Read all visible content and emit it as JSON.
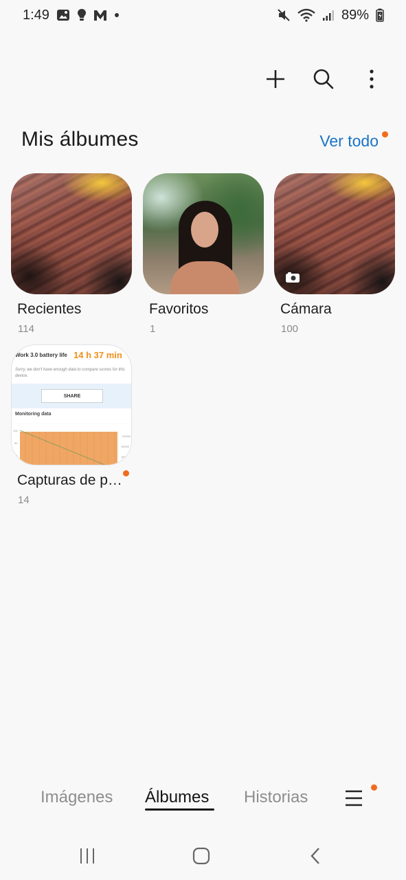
{
  "status_bar": {
    "time": "1:49",
    "battery": "89%",
    "icons": [
      "gallery-icon",
      "bulb-icon",
      "m-app-icon",
      "dot-icon",
      "mute-icon",
      "wifi-icon",
      "signal-icon",
      "battery-icon"
    ]
  },
  "toolbar": {
    "actions": [
      "add-icon",
      "search-icon",
      "more-vert-icon"
    ]
  },
  "section": {
    "title": "Mis álbumes",
    "view_all": "Ver todo"
  },
  "albums": [
    {
      "name": "Recientes",
      "count": "114"
    },
    {
      "name": "Favoritos",
      "count": "1"
    },
    {
      "name": "Cámara",
      "count": "100"
    },
    {
      "name": "Capturas de p…",
      "count": "14"
    }
  ],
  "screenshot_thumb": {
    "title": "Work 3.0 battery life",
    "time": "14 h 37 min",
    "sorry": "Sorry, we don't have enough data to compare scores for this device.",
    "share": "SHARE",
    "monitoring": "Monitoring data"
  },
  "tabs": [
    {
      "label": "Imágenes",
      "active": false
    },
    {
      "label": "Álbumes",
      "active": true
    },
    {
      "label": "Historias",
      "active": false
    }
  ],
  "colors": {
    "accent": "#1a74c4",
    "badge": "#f26b1d",
    "background": "#f8f8f8"
  },
  "navbar": {
    "buttons": [
      "recents-icon",
      "home-icon",
      "back-icon"
    ]
  }
}
